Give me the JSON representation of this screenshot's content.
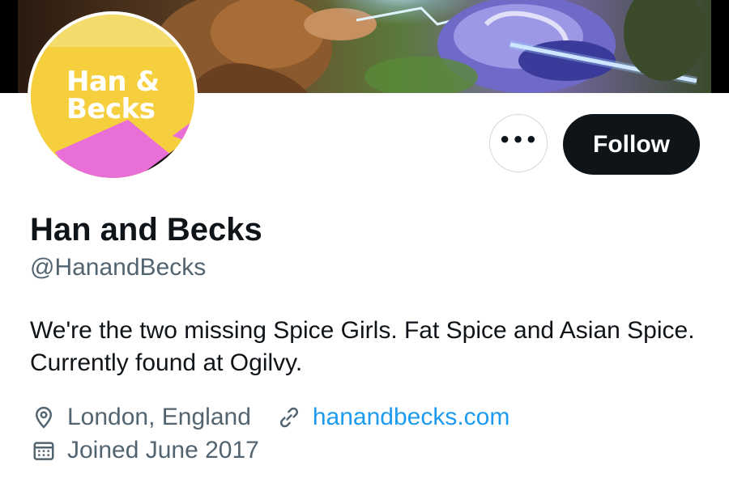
{
  "profile": {
    "avatar_line1": "Han &",
    "avatar_line2": "Becks",
    "display_name": "Han and Becks",
    "handle": "@HanandBecks",
    "bio": "We're the two missing Spice Girls. Fat Spice and Asian Spice. Currently found at Ogilvy.",
    "location": "London, England",
    "website": "hanandbecks.com",
    "joined": "Joined June 2017"
  },
  "actions": {
    "more_label": "•••",
    "follow_label": "Follow"
  },
  "icons": {
    "more": "more-options-icon",
    "location": "location-pin-icon",
    "website": "link-icon",
    "joined": "calendar-icon"
  },
  "colors": {
    "primary_text": "#0f1419",
    "secondary_text": "#536471",
    "link": "#1d9bf0",
    "follow_bg": "#0f1419",
    "avatar_yellow": "#f6cf3f",
    "avatar_pink": "#e86fd8"
  }
}
